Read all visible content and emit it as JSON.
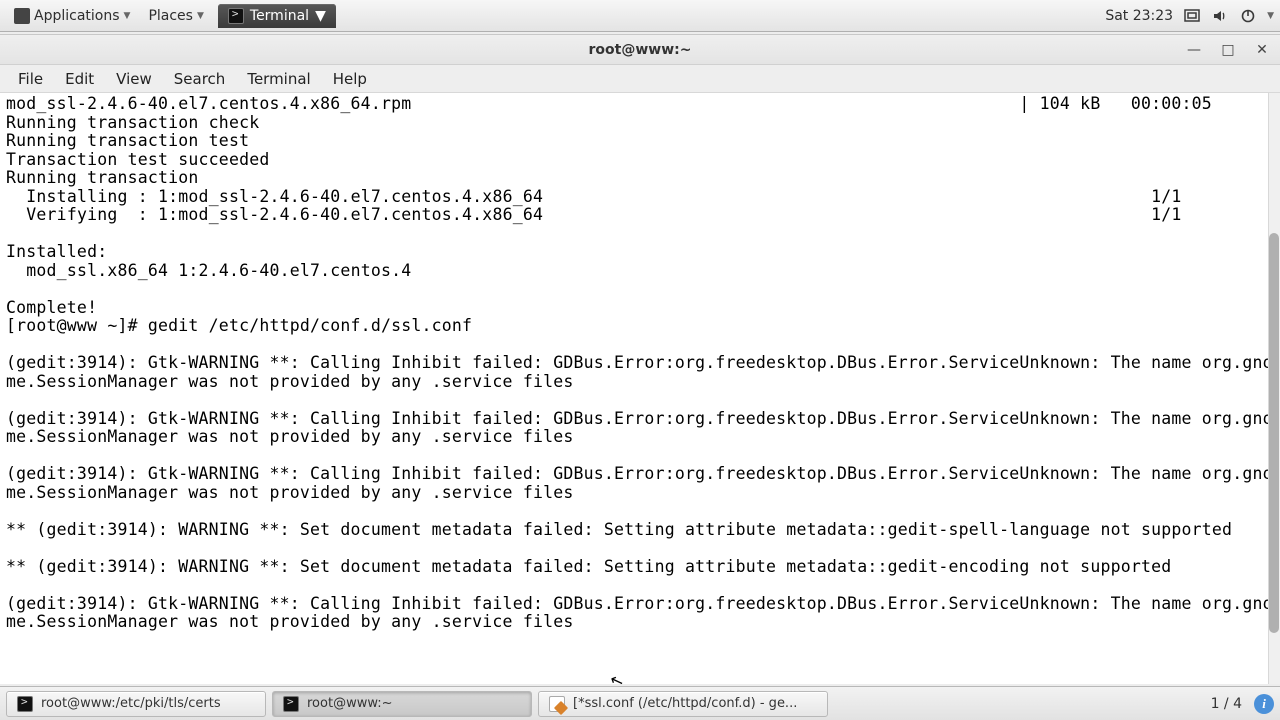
{
  "panel": {
    "applications": "Applications",
    "places": "Places",
    "active_app": "Terminal",
    "clock": "Sat 23:23"
  },
  "window": {
    "title": "root@www:~"
  },
  "menubar": {
    "file": "File",
    "edit": "Edit",
    "view": "View",
    "search": "Search",
    "terminal": "Terminal",
    "help": "Help"
  },
  "terminal": {
    "output": "mod_ssl-2.4.6-40.el7.centos.4.x86_64.rpm                                                            | 104 kB   00:00:05\nRunning transaction check\nRunning transaction test\nTransaction test succeeded\nRunning transaction\n  Installing : 1:mod_ssl-2.4.6-40.el7.centos.4.x86_64                                                            1/1\n  Verifying  : 1:mod_ssl-2.4.6-40.el7.centos.4.x86_64                                                            1/1\n\nInstalled:\n  mod_ssl.x86_64 1:2.4.6-40.el7.centos.4\n\nComplete!\n[root@www ~]# gedit /etc/httpd/conf.d/ssl.conf\n\n(gedit:3914): Gtk-WARNING **: Calling Inhibit failed: GDBus.Error:org.freedesktop.DBus.Error.ServiceUnknown: The name org.gnome.SessionManager was not provided by any .service files\n\n(gedit:3914): Gtk-WARNING **: Calling Inhibit failed: GDBus.Error:org.freedesktop.DBus.Error.ServiceUnknown: The name org.gnome.SessionManager was not provided by any .service files\n\n(gedit:3914): Gtk-WARNING **: Calling Inhibit failed: GDBus.Error:org.freedesktop.DBus.Error.ServiceUnknown: The name org.gnome.SessionManager was not provided by any .service files\n\n** (gedit:3914): WARNING **: Set document metadata failed: Setting attribute metadata::gedit-spell-language not supported\n\n** (gedit:3914): WARNING **: Set document metadata failed: Setting attribute metadata::gedit-encoding not supported\n\n(gedit:3914): Gtk-WARNING **: Calling Inhibit failed: GDBus.Error:org.freedesktop.DBus.Error.ServiceUnknown: The name org.gnome.SessionManager was not provided by any .service files"
  },
  "taskbar": {
    "items": [
      {
        "label": "root@www:/etc/pki/tls/certs"
      },
      {
        "label": "root@www:~"
      },
      {
        "label": "[*ssl.conf (/etc/httpd/conf.d) - ge..."
      }
    ],
    "workspace": "1 / 4"
  }
}
